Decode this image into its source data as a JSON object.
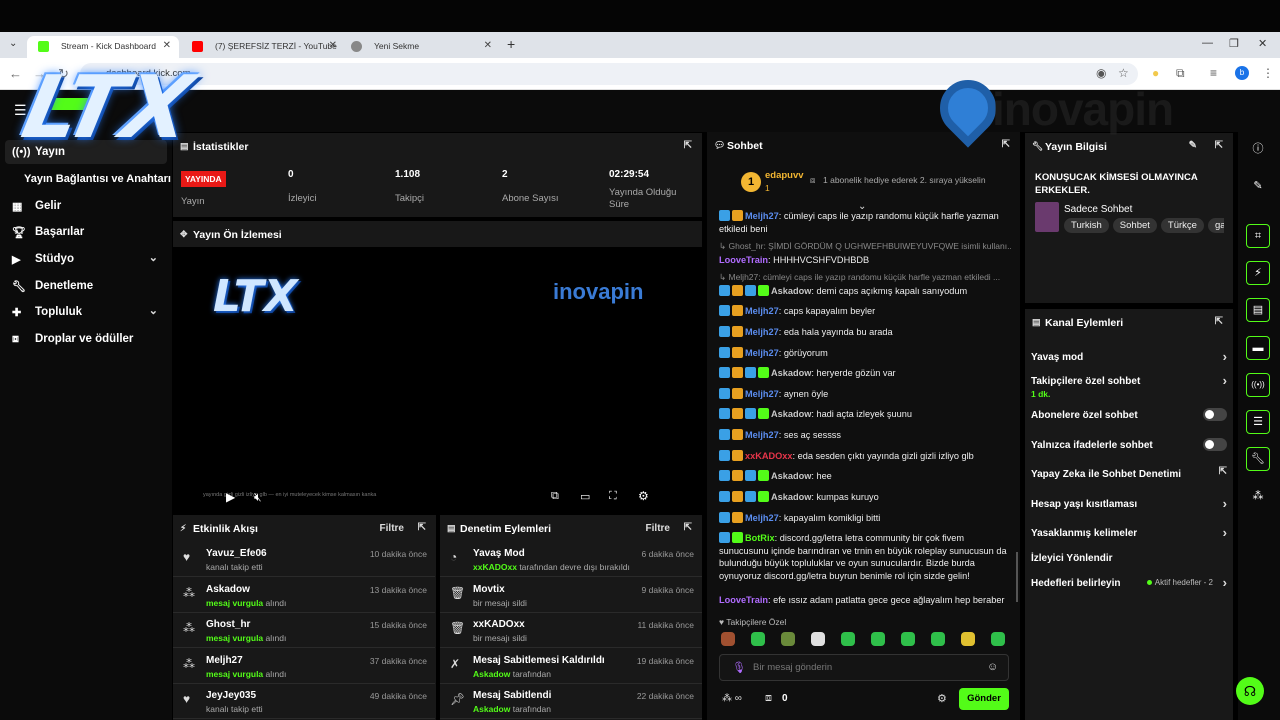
{
  "browser": {
    "tabs": [
      {
        "title": "Stream - Kick Dashboard",
        "color": "#53fc18"
      },
      {
        "title": "(7) ŞEREFSİZ TERZİ - YouTube",
        "color": "#ff0000"
      },
      {
        "title": "Yeni Sekme",
        "color": "#888888"
      }
    ],
    "url": "dashboard.kick.com",
    "profile_letter": "b"
  },
  "overlay": {
    "logo_text": "LTX",
    "sponsor_text": "inovapin"
  },
  "sidebar": {
    "items": [
      {
        "label": "Yayın",
        "icon": "broadcast-icon"
      },
      {
        "label": "Yayın Bağlantısı ve Anahtarı",
        "icon": ""
      },
      {
        "label": "Gelir",
        "icon": "revenue-icon"
      },
      {
        "label": "Başarılar",
        "icon": "trophy-icon"
      },
      {
        "label": "Stüdyo",
        "icon": "studio-icon"
      },
      {
        "label": "Denetleme",
        "icon": "wrench-icon"
      },
      {
        "label": "Topluluk",
        "icon": "community-icon"
      },
      {
        "label": "Droplar ve ödüller",
        "icon": "gift-icon"
      }
    ]
  },
  "stats": {
    "title": "İstatistikler",
    "live_badge": "YAYINDA",
    "live_label": "Yayın",
    "viewers": "0",
    "viewers_label": "İzleyici",
    "followers": "1.108",
    "followers_label": "Takipçi",
    "subs": "2",
    "subs_label": "Abone Sayısı",
    "uptime": "02:29:54",
    "uptime_label": "Yayında Olduğu Süre"
  },
  "preview": {
    "title": "Yayın Ön İzlemesi",
    "ticker": "yayında gizli gizli izliyo glb — en iyi muteleyecek kimse kalmasın kanka"
  },
  "activity": {
    "title": "Etkinlik Akışı",
    "filter": "Filtre",
    "rows": [
      {
        "name": "Yavuz_Efe06",
        "sub": "kanalı takip etti",
        "highlight": "",
        "time": "10 dakika önce",
        "icon": "heart-icon"
      },
      {
        "name": "Askadow",
        "sub": "alındı",
        "highlight": "mesaj vurgula",
        "time": "13 dakika önce",
        "icon": "emote-icon"
      },
      {
        "name": "Ghost_hr",
        "sub": "alındı",
        "highlight": "mesaj vurgula",
        "time": "15 dakika önce",
        "icon": "emote-icon"
      },
      {
        "name": "Meljh27",
        "sub": "alındı",
        "highlight": "mesaj vurgula",
        "time": "37 dakika önce",
        "icon": "emote-icon"
      },
      {
        "name": "JeyJey035",
        "sub": "kanalı takip etti",
        "highlight": "",
        "time": "49 dakika önce",
        "icon": "heart-icon"
      }
    ]
  },
  "moderation": {
    "title": "Denetim Eylemleri",
    "filter": "Filtre",
    "rows": [
      {
        "name": "Yavaş Mod",
        "sub": "tarafından devre dışı bırakıldı",
        "highlight": "xxKADOxx",
        "time": "6 dakika önce",
        "icon": "slow-mode-icon"
      },
      {
        "name": "Movtix",
        "sub": "bir mesajı sildi",
        "highlight": "",
        "time": "9 dakika önce",
        "icon": "trash-icon"
      },
      {
        "name": "xxKADOxx",
        "sub": "bir mesajı sildi",
        "highlight": "",
        "time": "11 dakika önce",
        "icon": "trash-icon"
      },
      {
        "name": "Mesaj Sabitlemesi Kaldırıldı",
        "sub": "tarafından",
        "highlight": "Askadow",
        "time": "19 dakika önce",
        "icon": "unpin-icon"
      },
      {
        "name": "Mesaj Sabitlendi",
        "sub": "tarafından",
        "highlight": "Askadow",
        "time": "22 dakika önce",
        "icon": "pin-icon"
      }
    ]
  },
  "chat": {
    "title": "Sohbet",
    "pinned_user": "edapuvv",
    "pinned_rank": "1",
    "pinned_count": "1",
    "pinned_msg": "1 abonelik hediye ederek 2. sıraya yükselin",
    "messages": [
      {
        "kind": "msg",
        "user": "Meljh27",
        "color": "#5b8def",
        "text": "cümleyi caps ile yazıp randomu küçük harfle yazman etkiledi beni"
      },
      {
        "kind": "reply",
        "text": "Ghost_hr: ŞİMDİ GÖRDÜM Q UGHWEFHBUIWEYUVFQWE isimli kullanı..."
      },
      {
        "kind": "msg",
        "user": "LooveTrain",
        "color": "#b06cff",
        "text": "HHHHVCSHFVDHBDB"
      },
      {
        "kind": "reply",
        "text": "Meljh27: cümleyi caps ile yazıp randomu küçük harfle yazman etkiledi ..."
      },
      {
        "kind": "msg",
        "user": "Askadow",
        "color": "#c8c8c8",
        "text": "demi caps açıkmış kapalı sanıyodum"
      },
      {
        "kind": "msg",
        "user": "Meljh27",
        "color": "#5b8def",
        "text": "caps kapayalım beyler"
      },
      {
        "kind": "msg",
        "user": "Meljh27",
        "color": "#5b8def",
        "text": "eda hala yayında bu arada"
      },
      {
        "kind": "msg",
        "user": "Meljh27",
        "color": "#5b8def",
        "text": "görüyorum"
      },
      {
        "kind": "msg",
        "user": "Askadow",
        "color": "#c8c8c8",
        "text": "heryerde gözün var"
      },
      {
        "kind": "msg",
        "user": "Meljh27",
        "color": "#5b8def",
        "text": "aynen öyle"
      },
      {
        "kind": "msg",
        "user": "Askadow",
        "color": "#c8c8c8",
        "text": "hadi açta izleyek şuunu"
      },
      {
        "kind": "msg",
        "user": "Meljh27",
        "color": "#5b8def",
        "text": "ses aç sessss"
      },
      {
        "kind": "msg",
        "user": "xxKADOxx",
        "color": "#e8354a",
        "text": "eda sesden çıktı yayında gizli gizli izliyo glb"
      },
      {
        "kind": "msg",
        "user": "Askadow",
        "color": "#c8c8c8",
        "text": "hee"
      },
      {
        "kind": "msg",
        "user": "Askadow",
        "color": "#c8c8c8",
        "text": "kumpas kuruyo"
      },
      {
        "kind": "msg",
        "user": "Meljh27",
        "color": "#5b8def",
        "text": "kapayalım komikligi bitti"
      },
      {
        "kind": "msg",
        "user": "BotRix",
        "color": "#53fc18",
        "text": "discord.gg/letra letra community bir çok fivem sunucusunu içinde barındıran ve trnin en büyük roleplay sunucusun da bulunduğu büyük topluluklar ve oyun sunuculardır. Bizde burda oynuyoruz discord.gg/letra buyrun benimle rol için sizde gelin!"
      },
      {
        "kind": "msg",
        "user": "LooveTrain",
        "color": "#b06cff",
        "text": "efe ıssız adam patlatta gece gece ağlayalım hep beraber"
      }
    ],
    "followers_only": "Takipçilere Özel",
    "input_placeholder": "Bir mesaj gönderin",
    "points": "0",
    "send": "Gönder"
  },
  "stream_info": {
    "title": "Yayın Bilgisi",
    "headline": "KONUŞUCAK KİMSESİ OLMAYINCA ERKEKLER.",
    "category": "Sadece Sohbet",
    "tags": [
      "Turkish",
      "Sohbet",
      "Türkçe",
      "gamer"
    ]
  },
  "channel_actions": {
    "title": "Kanal Eylemleri",
    "items": [
      {
        "label": "Yavaş mod",
        "type": "chevron"
      },
      {
        "label": "Takipçilere özel sohbet",
        "type": "chevron",
        "sub": "1 dk."
      },
      {
        "label": "Abonelere özel sohbet",
        "type": "toggle"
      },
      {
        "label": "Yalnızca ifadelerle sohbet",
        "type": "toggle"
      },
      {
        "label": "Yapay Zeka ile Sohbet Denetimi",
        "type": "external"
      },
      {
        "label": "Hesap yaşı kısıtlaması",
        "type": "chevron"
      },
      {
        "label": "Yasaklanmış kelimeler",
        "type": "chevron"
      },
      {
        "label": "İzleyici Yönlendir",
        "type": "none"
      },
      {
        "label": "Hedefleri belirleyin",
        "type": "chevron",
        "extra": "Aktif hedefler - 2"
      }
    ]
  },
  "colors": {
    "accent": "#53fc18",
    "live": "#e91916",
    "panel": "#181818"
  }
}
